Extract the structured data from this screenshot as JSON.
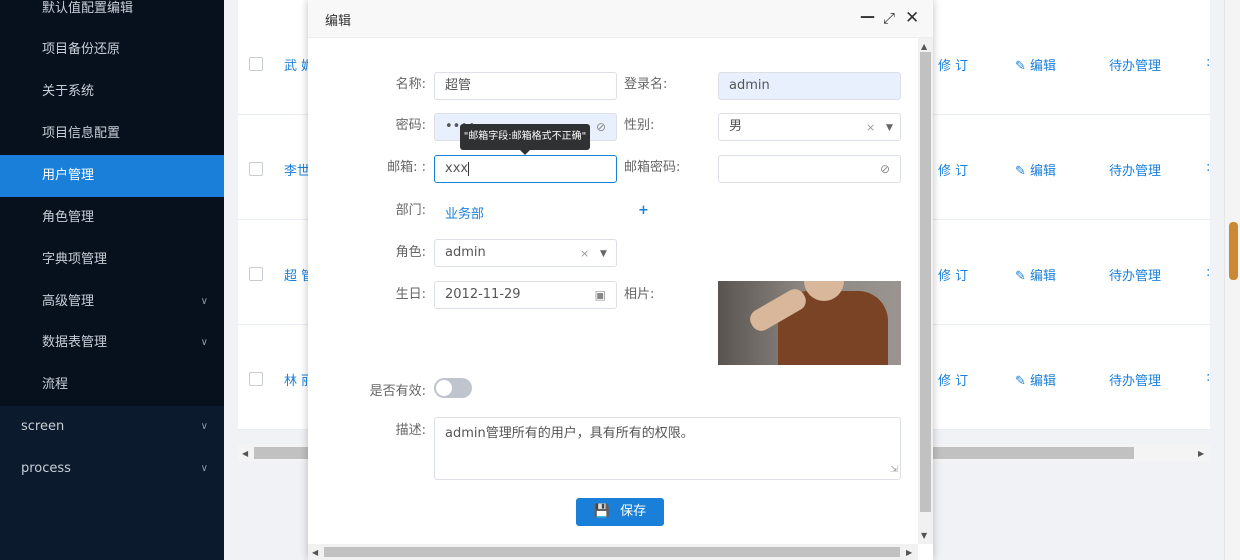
{
  "sidebar": {
    "items": [
      {
        "label": "默认值配置编辑"
      },
      {
        "label": "项目备份还原"
      },
      {
        "label": "关于系统"
      },
      {
        "label": "项目信息配置"
      },
      {
        "label": "用户管理"
      },
      {
        "label": "角色管理"
      },
      {
        "label": "字典项管理"
      },
      {
        "label": "高级管理"
      },
      {
        "label": "数据表管理"
      },
      {
        "label": "流程"
      }
    ],
    "groups": [
      {
        "label": "screen"
      },
      {
        "label": "process"
      }
    ]
  },
  "table": {
    "rows": [
      {
        "name": "武 媚",
        "act1": "修 订",
        "act2": "编辑",
        "act3": "待办管理"
      },
      {
        "name": "李世",
        "act1": "修 订",
        "act2": "编辑",
        "act3": "待办管理"
      },
      {
        "name": "超 管",
        "act1": "修 订",
        "act2": "编辑",
        "act3": "待办管理"
      },
      {
        "name": "林 丽",
        "act1": "修 订",
        "act2": "编辑",
        "act3": "待办管理"
      }
    ]
  },
  "dialog": {
    "title": "编辑",
    "form": {
      "name_label": "名称:",
      "name_value": "超管",
      "login_label": "登录名:",
      "login_value": "admin",
      "password_label": "密码:",
      "password_value": "••••",
      "gender_label": "性别:",
      "gender_value": "男",
      "email_label": "邮箱: :",
      "email_value": "xxx",
      "email_pwd_label": "邮箱密码:",
      "dept_label": "部门:",
      "dept_value": "业务部",
      "dept_add": "+",
      "role_label": "角色:",
      "role_value": "admin",
      "birthday_label": "生日:",
      "birthday_value": "2012-11-29",
      "photo_label": "相片:",
      "active_label": "是否有效:",
      "active": false,
      "desc_label": "描述:",
      "desc_value": "admin管理所有的用户，具有所有的权限。"
    },
    "tooltip": "\"邮箱字段:邮箱格式不正确\"",
    "save_label": "保存"
  }
}
